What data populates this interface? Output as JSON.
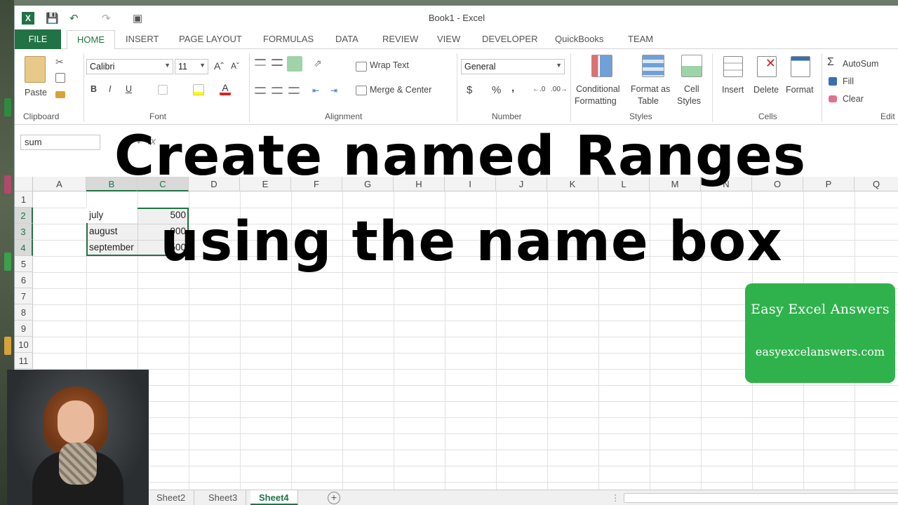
{
  "window": {
    "title": "Book1 - Excel"
  },
  "menu_tabs": [
    "FILE",
    "HOME",
    "INSERT",
    "PAGE LAYOUT",
    "FORMULAS",
    "DATA",
    "REVIEW",
    "VIEW",
    "DEVELOPER",
    "QuickBooks",
    "TEAM"
  ],
  "ribbon": {
    "clipboard": {
      "paste": "Paste",
      "label": "Clipboard"
    },
    "font": {
      "name": "Calibri",
      "size": "11",
      "bold": "B",
      "italic": "I",
      "underline": "U",
      "label": "Font"
    },
    "alignment": {
      "wrap": "Wrap Text",
      "merge": "Merge & Center",
      "label": "Alignment"
    },
    "number": {
      "format": "General",
      "currency": "$",
      "percent": "%",
      "comma": ",",
      "label": "Number"
    },
    "styles": {
      "conditional1": "Conditional",
      "conditional2": "Formatting",
      "format_table1": "Format as",
      "format_table2": "Table",
      "cell_styles1": "Cell",
      "cell_styles2": "Styles",
      "label": "Styles"
    },
    "cells": {
      "insert": "Insert",
      "delete": "Delete",
      "format": "Format",
      "label": "Cells"
    },
    "editing": {
      "autosum": "AutoSum",
      "fill": "Fill",
      "clear": "Clear",
      "label": "Edit"
    }
  },
  "formula_bar": {
    "name_box": "sum"
  },
  "columns": [
    "A",
    "B",
    "C",
    "D",
    "E",
    "F",
    "G",
    "H",
    "I",
    "J",
    "K",
    "L",
    "M",
    "N",
    "O",
    "P",
    "Q"
  ],
  "rows": [
    "1",
    "2",
    "3",
    "4",
    "5",
    "6",
    "7",
    "8",
    "9",
    "10",
    "11"
  ],
  "cells": {
    "b2": "july",
    "c2": "500",
    "b3": "august",
    "c3": "900",
    "b4": "september",
    "c4": "500"
  },
  "sheets": [
    "Sheet2",
    "Sheet3",
    "Sheet4"
  ],
  "active_sheet": "Sheet4",
  "headline": {
    "line1": "Create named Ranges",
    "line2": "using the name box"
  },
  "badge": {
    "title": "Easy Excel Answers",
    "url": "easyexcelanswers.com"
  },
  "colors": {
    "excel_green": "#217346",
    "badge_green": "#2fb24c"
  }
}
